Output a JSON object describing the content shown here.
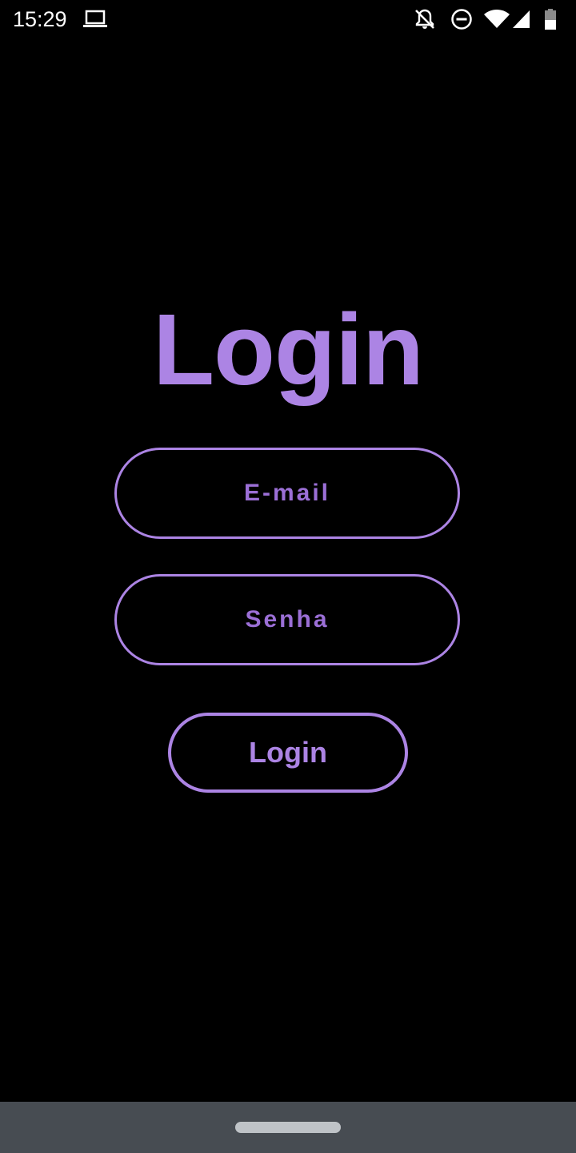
{
  "status_bar": {
    "time": "15:29",
    "icons": [
      "laptop-icon",
      "notifications-off-icon",
      "do-not-disturb-icon",
      "wifi-icon",
      "cellular-signal-icon",
      "battery-icon"
    ]
  },
  "login": {
    "title": "Login",
    "email_placeholder": "E-mail",
    "email_value": "",
    "password_placeholder": "Senha",
    "password_value": "",
    "button_label": "Login"
  },
  "colors": {
    "accent": "#ac84e4",
    "placeholder": "#9b6fd6",
    "background": "#000000",
    "nav_bar": "#474c52"
  }
}
